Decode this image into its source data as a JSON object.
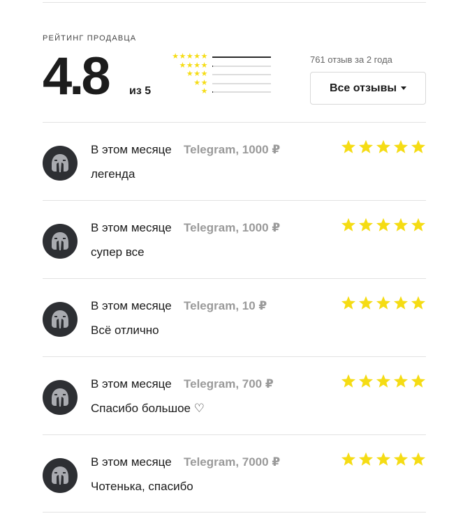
{
  "header": {
    "section_title": "РЕЙТИНГ ПРОДАВЦА",
    "rating_value": "4.8",
    "rating_of": "из 5",
    "review_count_text": "761 отзыв за 2 года",
    "all_reviews_button": "Все отзывы"
  },
  "distribution": [
    {
      "stars": 5,
      "stars_glyph": "★★★★★",
      "fraction": 1.0
    },
    {
      "stars": 4,
      "stars_glyph": "★★★★",
      "fraction": 0.01
    },
    {
      "stars": 3,
      "stars_glyph": "★★★",
      "fraction": 0.0
    },
    {
      "stars": 2,
      "stars_glyph": "★★",
      "fraction": 0.0
    },
    {
      "stars": 1,
      "stars_glyph": "★",
      "fraction": 0.01
    }
  ],
  "colors": {
    "star": "#f5dc14",
    "avatar_bg": "#2d2f33",
    "muted_text": "#9a9a9a"
  },
  "reviews": [
    {
      "date": "В этом месяце",
      "source": "Telegram, 1000 ₽",
      "text": "легенда",
      "rating": 5,
      "avatar_icon": "helmet-icon"
    },
    {
      "date": "В этом месяце",
      "source": "Telegram, 1000 ₽",
      "text": "супер все",
      "rating": 5,
      "avatar_icon": "helmet-icon"
    },
    {
      "date": "В этом месяце",
      "source": "Telegram, 10 ₽",
      "text": "Всё отлично",
      "rating": 5,
      "avatar_icon": "helmet-icon"
    },
    {
      "date": "В этом месяце",
      "source": "Telegram, 700 ₽",
      "text": "Спасибо большое ♡",
      "rating": 5,
      "avatar_icon": "helmet-icon"
    },
    {
      "date": "В этом месяце",
      "source": "Telegram, 7000 ₽",
      "text": "Чотенька, спасибо",
      "rating": 5,
      "avatar_icon": "helmet-icon"
    }
  ]
}
